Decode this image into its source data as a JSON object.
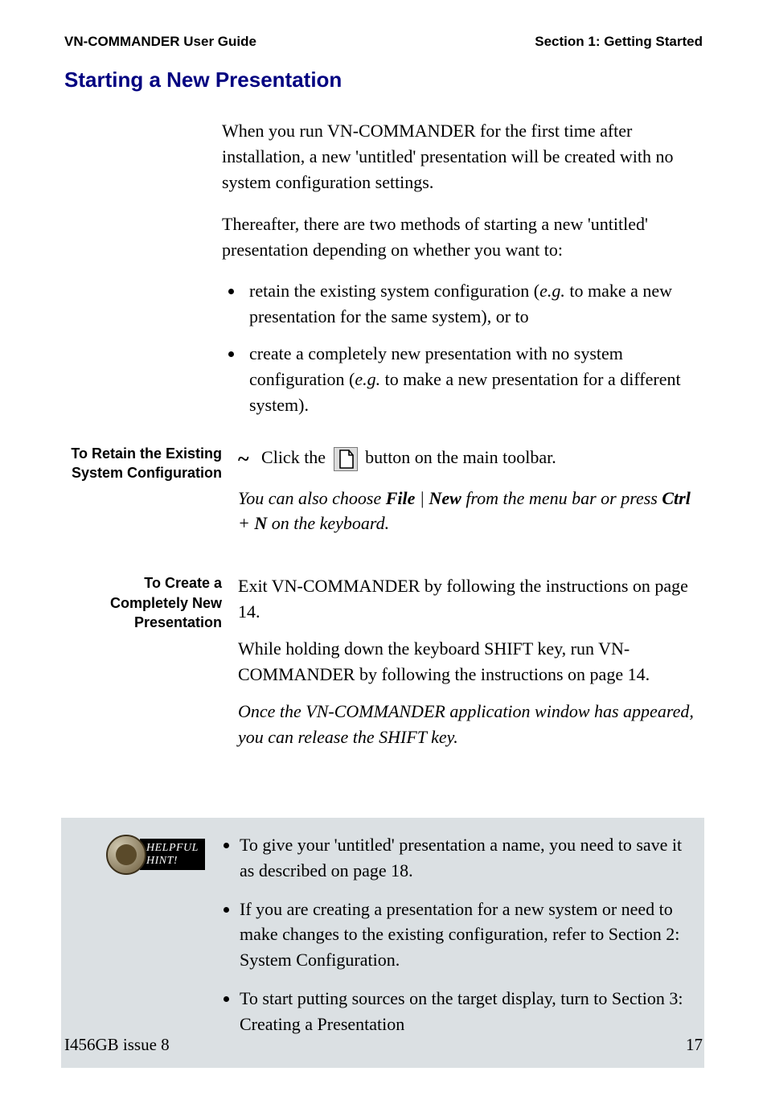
{
  "header": {
    "left": "VN-COMMANDER User Guide",
    "right": "Section 1: Getting Started"
  },
  "heading": "Starting a New Presentation",
  "intro": {
    "p1": "When you run VN-COMMANDER for the first time after installation, a new 'untitled' presentation will be created with no system configuration settings.",
    "p2": "Thereafter, there are two methods of starting a new 'untitled' presentation depending on whether you want to:",
    "bullets": [
      {
        "pre": "retain the existing system configuration (",
        "eg": "e.g.",
        "post": " to make a new presentation for the same system), or to"
      },
      {
        "pre": "create a completely new presentation with no system configuration (",
        "eg": "e.g.",
        "post": " to make a new presentation for a different system)."
      }
    ]
  },
  "retain": {
    "label": "To Retain the Existing System Configuration",
    "line1_pre": "Click the",
    "line1_post": "button on the main toolbar.",
    "line2_pre": "You can also choose ",
    "file": "File",
    "pipe": " | ",
    "new": "New",
    "line2_mid": " from the menu bar or press ",
    "ctrl": "Ctrl",
    "plus": " + ",
    "n": "N",
    "line2_post": " on the keyboard."
  },
  "create": {
    "label": "To Create a Completely New Presentation",
    "p1": "Exit VN-COMMANDER by following the instructions on page 14.",
    "p2": "While holding down the keyboard SHIFT key, run VN-COMMANDER by following the instructions on page 14.",
    "p3": "Once the VN-COMMANDER application window has appeared, you can release the SHIFT key."
  },
  "hint": {
    "badge_line1": "HELPFUL",
    "badge_line2": "HINT!",
    "items": [
      "To give your 'untitled' presentation a name, you need to save it as described on page 18.",
      "If you are creating a presentation for a new system or need to make changes to the existing configuration, refer to Section 2: System Configuration.",
      "To start putting sources on the target display, turn to Section 3: Creating a Presentation"
    ]
  },
  "footer": {
    "left": "I456GB issue 8",
    "right": "17"
  }
}
